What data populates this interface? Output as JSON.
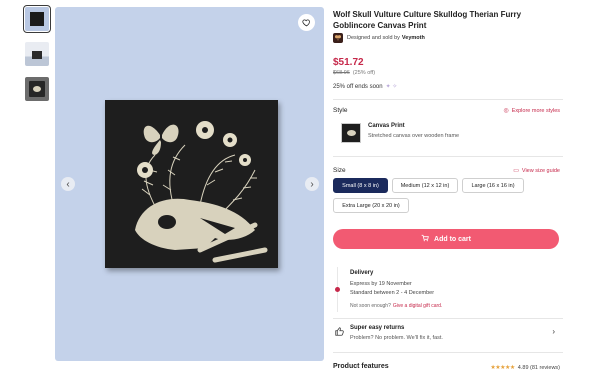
{
  "product": {
    "title": "Wolf Skull Vulture Culture Skulldog Therian Furry Goblincore Canvas Print",
    "seller_prefix": "Designed and sold by",
    "seller_name": "Veymoth",
    "price": "$51.72",
    "original_price": "$68.96",
    "discount": "(25% off)",
    "promo": "25% off ends soon"
  },
  "gallery": {
    "thumbnails": [
      "canvas-front",
      "room-view",
      "detail-view"
    ],
    "favorite_icon": "heart-icon",
    "prev_icon": "chevron-left-icon",
    "next_icon": "chevron-right-icon"
  },
  "style": {
    "label": "Style",
    "explore_link": "Explore more styles",
    "selected_name": "Canvas Print",
    "selected_desc": "Stretched canvas over wooden frame"
  },
  "size": {
    "label": "Size",
    "guide_link": "View size guide",
    "options": [
      "Small (8 x 8 in)",
      "Medium (12 x 12 in)",
      "Large (16 x 16 in)",
      "Extra Large (20 x 20 in)"
    ],
    "selected": "Small (8 x 8 in)"
  },
  "cart": {
    "label": "Add to cart"
  },
  "delivery": {
    "title": "Delivery",
    "express": "Express by 19 November",
    "standard": "Standard between 2 - 4 December",
    "not_soon_prefix": "Not soon enough?",
    "gift_card_link": "Give a digital gift card."
  },
  "returns": {
    "title": "Super easy returns",
    "subtitle": "Problem? No problem. We'll fix it, fast."
  },
  "features": {
    "label": "Product features",
    "rating": "4.89",
    "reviews": "(81 reviews)"
  },
  "colors": {
    "accent": "#c6284a",
    "cart_button": "#f25a72",
    "selected_chip": "#1b2a5c",
    "hero_bg": "#c4d2ea"
  }
}
